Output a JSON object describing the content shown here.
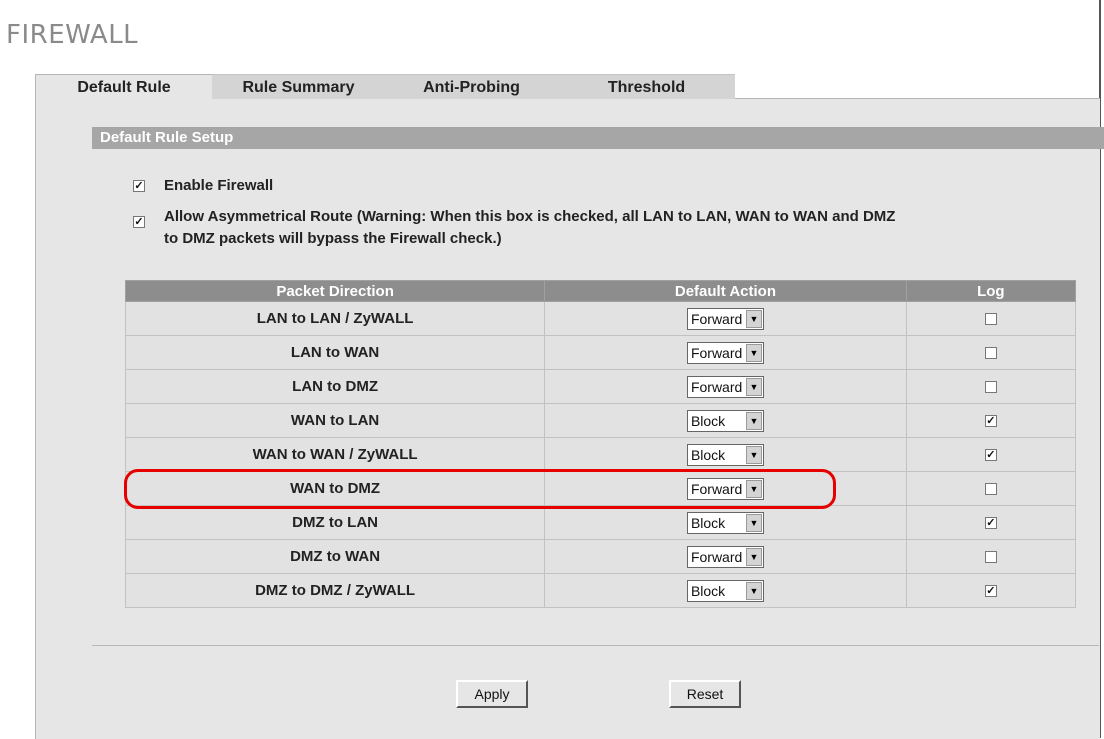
{
  "page": {
    "title": "FIREWALL"
  },
  "tabs": [
    {
      "label": "Default Rule",
      "active": true
    },
    {
      "label": "Rule Summary",
      "active": false
    },
    {
      "label": "Anti-Probing",
      "active": false
    },
    {
      "label": "Threshold",
      "active": false
    }
  ],
  "section": {
    "title": "Default Rule Setup"
  },
  "options": {
    "enable_firewall": {
      "label": "Enable Firewall",
      "checked": true
    },
    "asymmetrical": {
      "line1": "Allow Asymmetrical Route (Warning: When this box is checked, all LAN to LAN, WAN to WAN and DMZ",
      "line2": "to DMZ packets will bypass the Firewall check.)",
      "checked": true
    }
  },
  "table": {
    "headers": {
      "direction": "Packet Direction",
      "action": "Default Action",
      "log": "Log"
    },
    "rows": [
      {
        "direction": "LAN to LAN / ZyWALL",
        "action": "Forward",
        "log": false
      },
      {
        "direction": "LAN to WAN",
        "action": "Forward",
        "log": false
      },
      {
        "direction": "LAN to DMZ",
        "action": "Forward",
        "log": false
      },
      {
        "direction": "WAN to LAN",
        "action": "Block",
        "log": true
      },
      {
        "direction": "WAN to WAN / ZyWALL",
        "action": "Block",
        "log": true
      },
      {
        "direction": "WAN to DMZ",
        "action": "Forward",
        "log": false,
        "highlighted": true
      },
      {
        "direction": "DMZ to LAN",
        "action": "Block",
        "log": true
      },
      {
        "direction": "DMZ to WAN",
        "action": "Forward",
        "log": false
      },
      {
        "direction": "DMZ to DMZ / ZyWALL",
        "action": "Block",
        "log": true
      }
    ]
  },
  "buttons": {
    "apply": "Apply",
    "reset": "Reset"
  },
  "icons": {
    "check": "✓",
    "dropdown": "▼"
  },
  "colors": {
    "highlight": "#e60000",
    "header": "#8d8d8d",
    "section_bar": "#a6a6a6"
  }
}
